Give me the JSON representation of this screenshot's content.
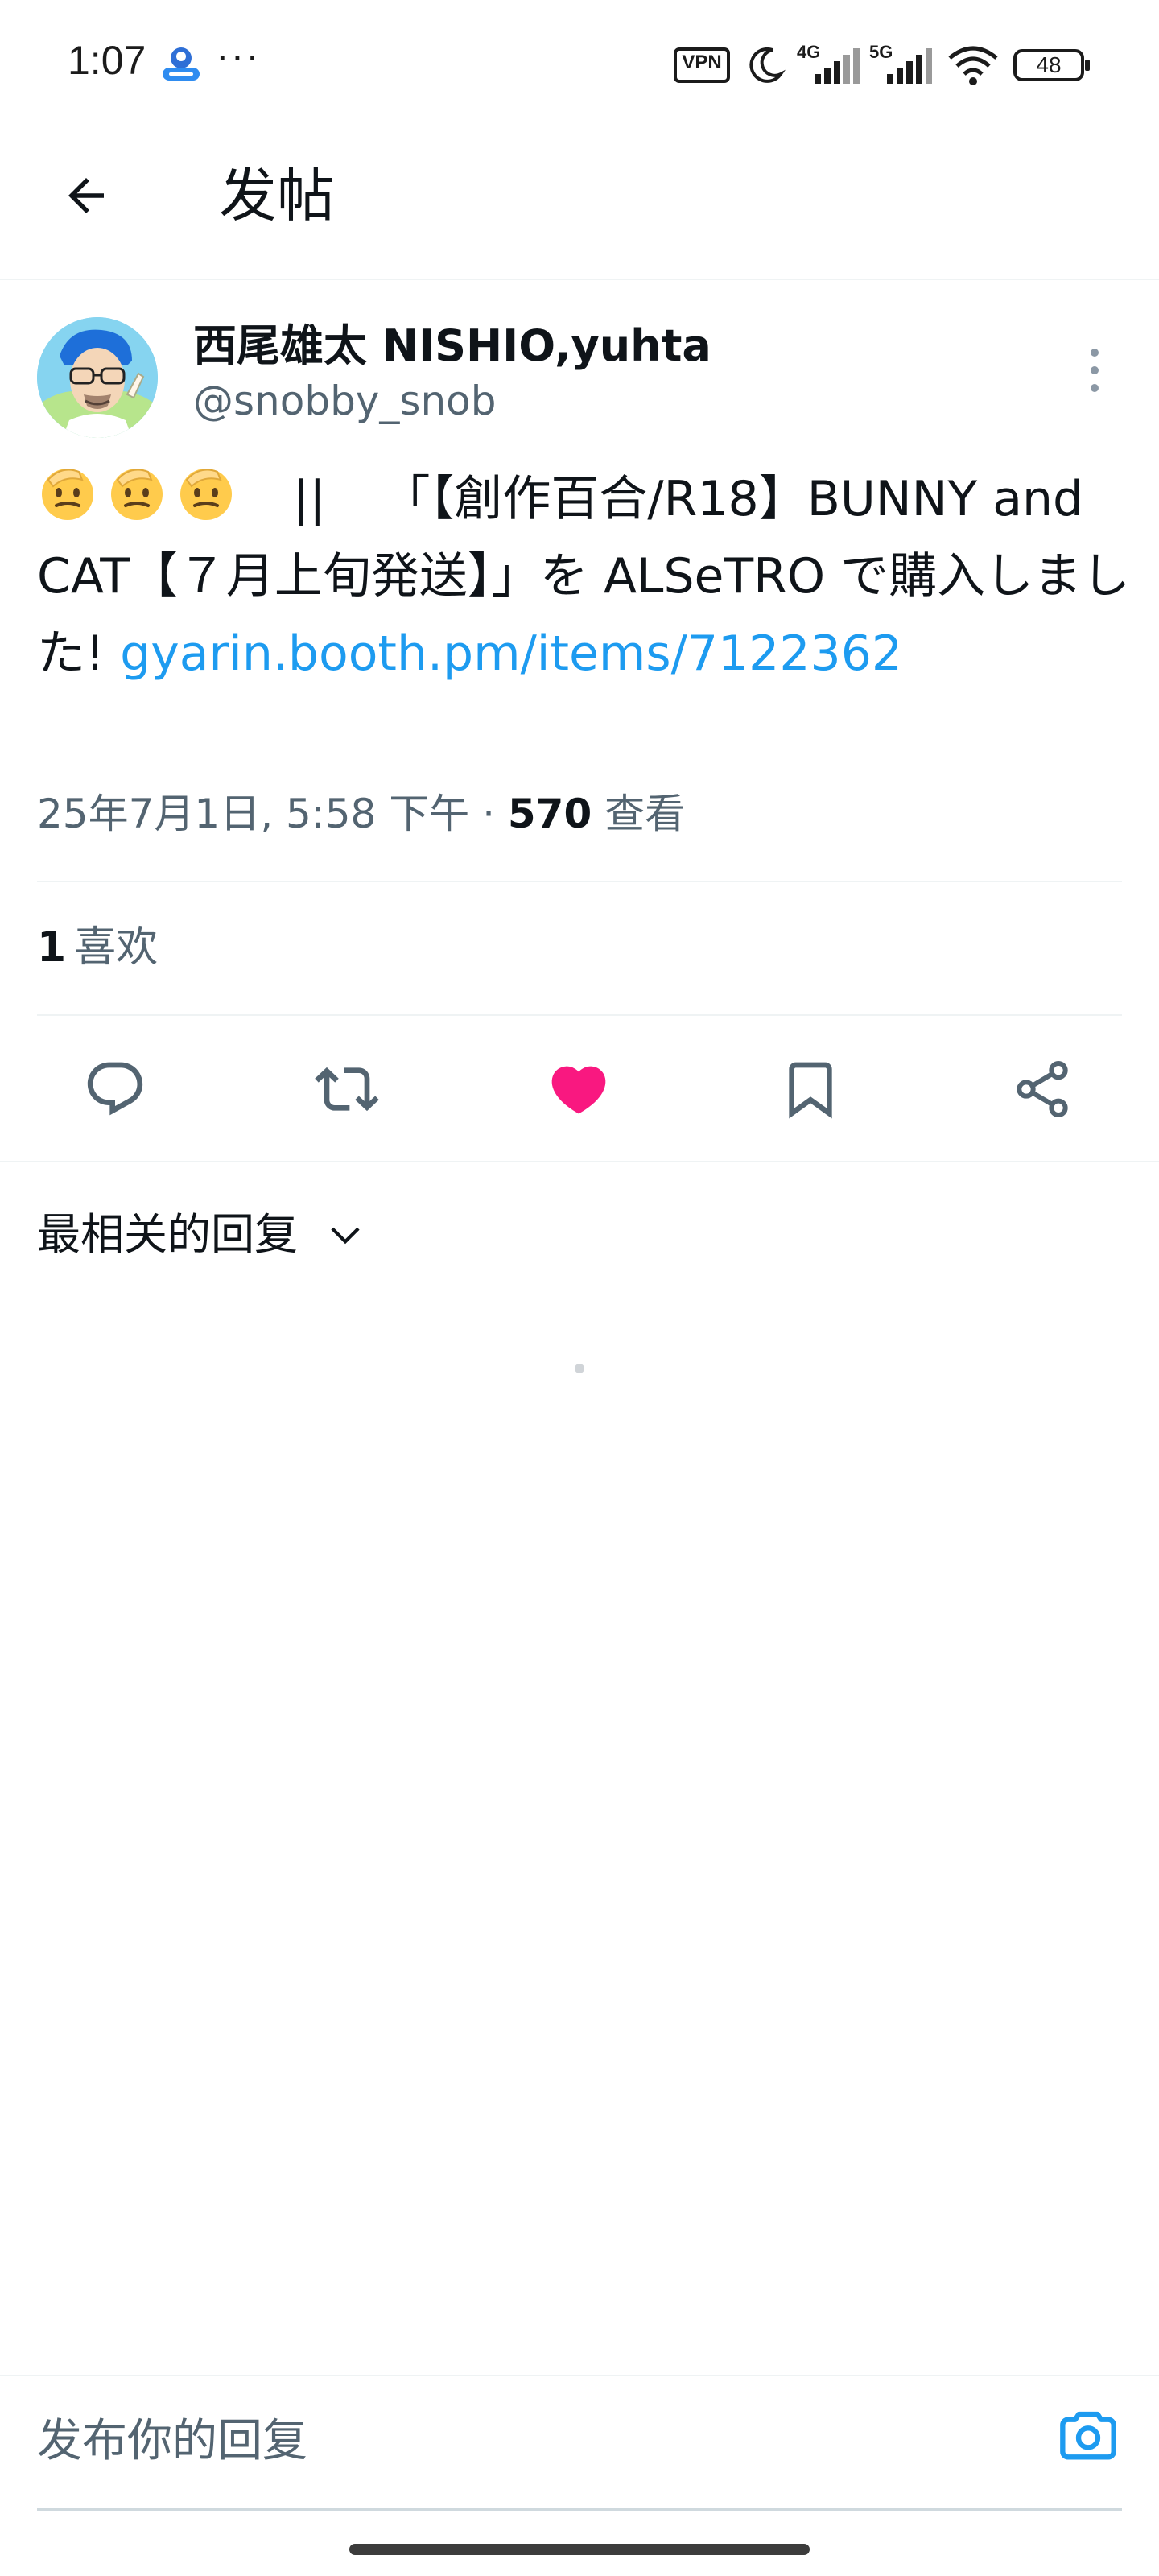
{
  "status_bar": {
    "time": "1:07",
    "dots": "···",
    "vpn_label": "VPN",
    "net1": "4G",
    "net2": "5G",
    "battery": "48",
    "app_icon": "cloud-app-icon"
  },
  "header": {
    "title": "发帖",
    "back_icon": "arrow-left-icon"
  },
  "post": {
    "author_name": "西尾雄太 NISHIO,yuhta",
    "author_handle": "@snobby_snob",
    "emoji_count": 3,
    "text_separator": "||",
    "text_body": "「【創作百合/R18】BUNNY and CAT【７月上旬発送】」を ALSeTRO で購入しました! ",
    "link": "gyarin.booth.pm/items/7122362",
    "timestamp": "25年7月1日, 5:58 下午 · ",
    "views_count": "570",
    "views_label": " 查看",
    "likes_count": "1",
    "likes_label": "喜欢",
    "liked": true
  },
  "actions": {
    "reply_icon": "reply-icon",
    "repost_icon": "repost-icon",
    "like_icon": "heart-icon",
    "bookmark_icon": "bookmark-icon",
    "share_icon": "share-icon"
  },
  "replies": {
    "sort_label": "最相关的回复"
  },
  "reply_bar": {
    "placeholder": "发布你的回复"
  },
  "colors": {
    "link": "#1d9bf0",
    "like": "#f91880",
    "muted": "#536471",
    "text": "#0f1419",
    "divider": "#eff3f4"
  }
}
